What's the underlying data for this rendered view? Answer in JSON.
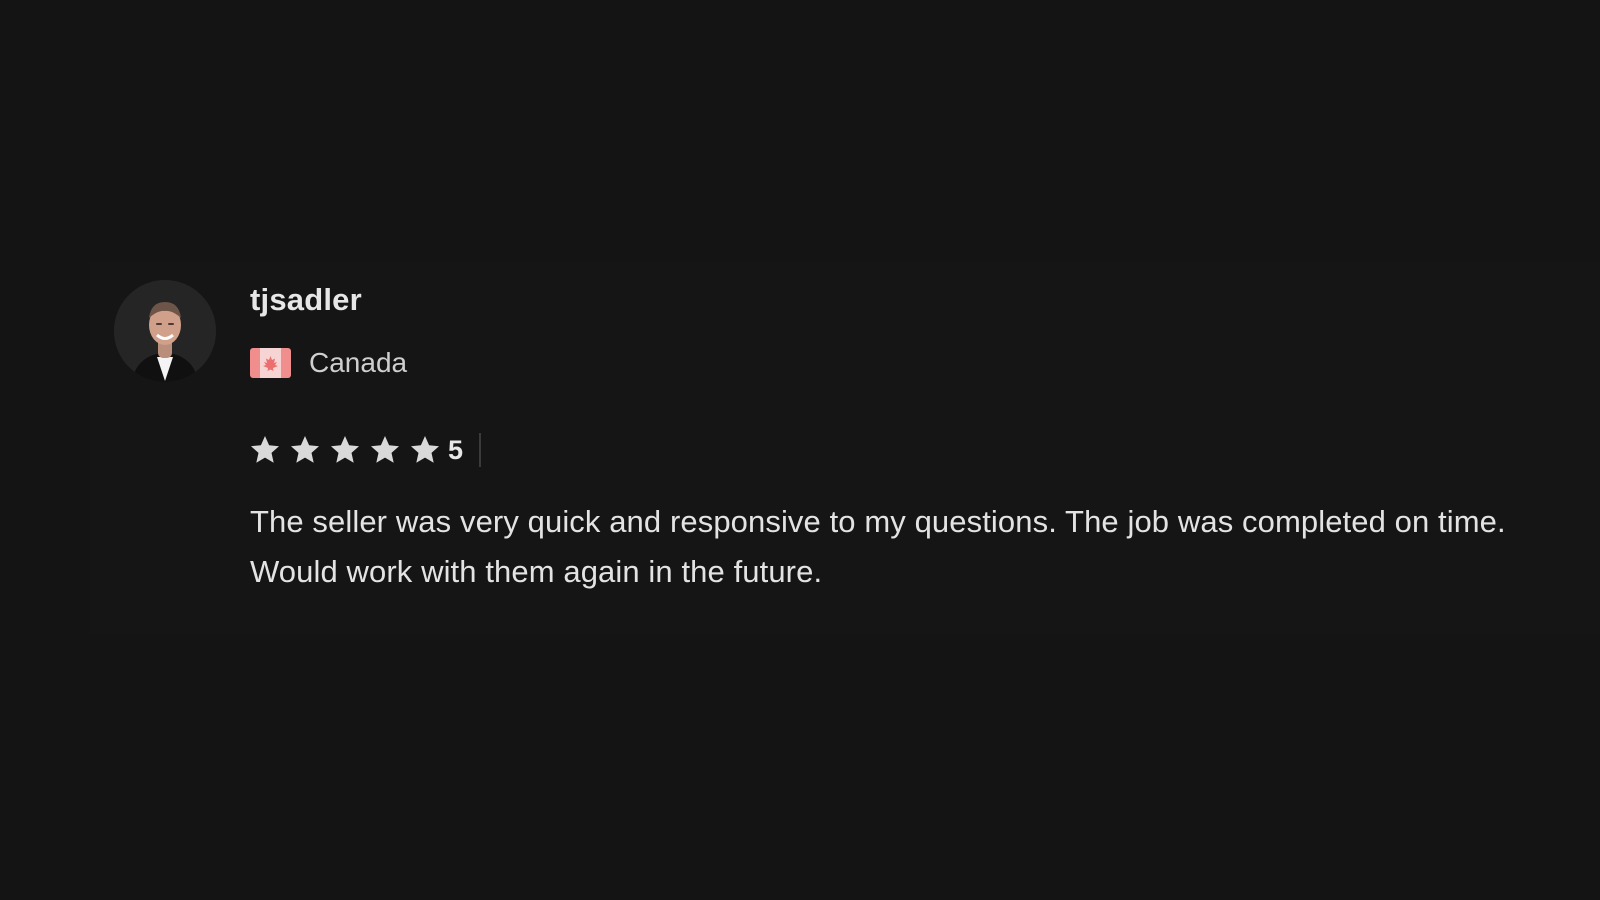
{
  "review": {
    "username": "tjsadler",
    "country": "Canada",
    "country_flag_icon": "canada-flag-icon",
    "rating": "5",
    "rating_stars": 5,
    "rating_max_stars": 5,
    "star_icon": "star-icon",
    "text": "The seller was very quick and responsive to my questions. The job was completed on time. Would work with them again in the future."
  },
  "colors": {
    "background": "#141414",
    "text_primary": "#e7e7e7",
    "text_secondary": "#cfcfcf",
    "star": "#d9d9d9",
    "flag_red": "#f08d8d"
  }
}
